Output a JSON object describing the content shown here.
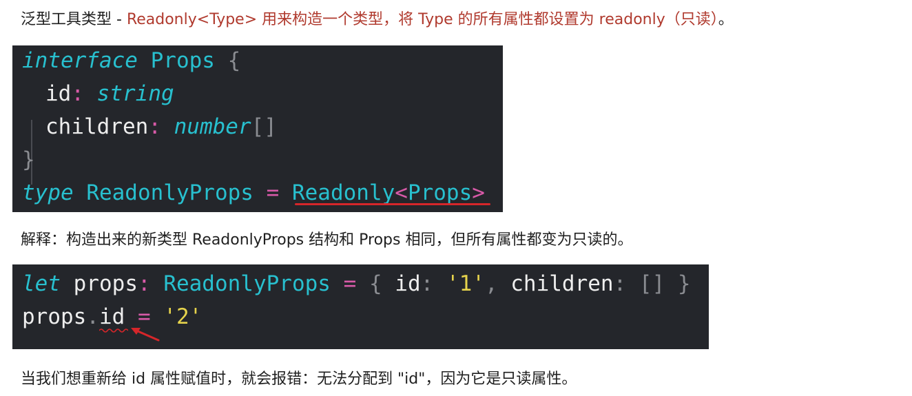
{
  "intro": {
    "prefix": "泛型工具类型 - ",
    "highlight": "Readonly<Type> 用来构造一个类型，将 Type 的所有属性都设置为 readonly（只读）",
    "suffix": "。"
  },
  "code_block_1": {
    "l1_kw": "interface",
    "l1_name": " Props",
    "l1_brace": " {",
    "l2_prop": "id",
    "l2_colon": ":",
    "l2_type": " string",
    "l3_prop": "children",
    "l3_colon": ":",
    "l3_type": " number",
    "l3_arr": "[]",
    "l4_brace": "}",
    "l5_kw": "type",
    "l5_name": " ReadonlyProps",
    "l5_eq": " = ",
    "l5_util": "Readonly",
    "l5_lt": "<",
    "l5_arg": "Props",
    "l5_gt": ">"
  },
  "explanation": "解释：构造出来的新类型 ReadonlyProps 结构和 Props 相同，但所有属性都变为只读的。",
  "code_block_2": {
    "l1_kw": "let",
    "l1_var": " props",
    "l1_colon": ":",
    "l1_type": " ReadonlyProps",
    "l1_eq": " = ",
    "l1_open": "{ ",
    "l1_k1": "id",
    "l1_c1": ": ",
    "l1_v1": "'1'",
    "l1_comma": ", ",
    "l1_k2": "children",
    "l1_c2": ": ",
    "l1_v2": "[]",
    "l1_close": " }",
    "l2_obj": "props",
    "l2_dot": ".",
    "l2_prop": "id",
    "l2_eq": " = ",
    "l2_val": "'2'"
  },
  "error_note": "当我们想重新给 id 属性赋值时，就会报错：无法分配到 \"id\"，因为它是只读属性。",
  "colors": {
    "code_bg": "#24262b",
    "keyword": "#28c0cf",
    "operator": "#d85aa8",
    "string": "#e6d34c",
    "highlight_text": "#b03a2e",
    "annotation_red": "#d6262a"
  }
}
